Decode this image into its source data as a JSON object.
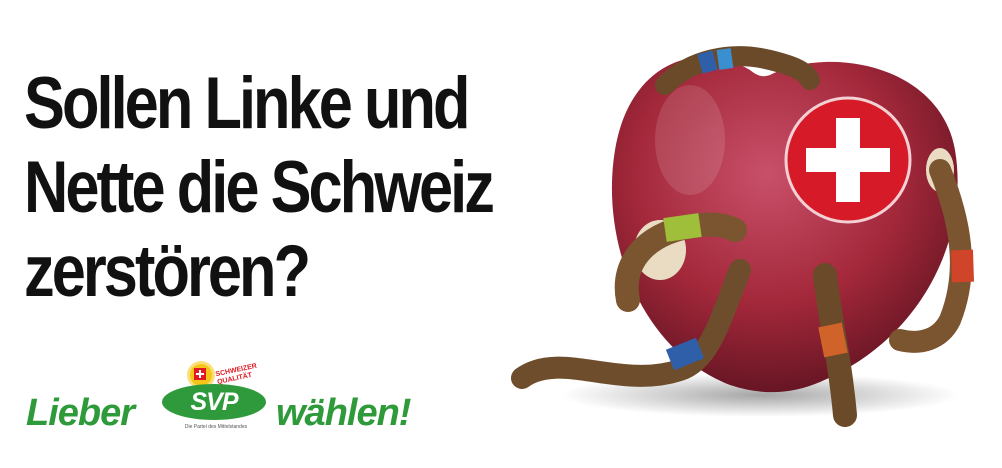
{
  "headline": {
    "line1": "Sollen Linke und",
    "line2": "Nette die Schweiz",
    "line3": "zerstören?"
  },
  "slogan": {
    "before": "Lieber",
    "after": "wählen!"
  },
  "logo": {
    "name": "SVP",
    "quality_line1": "SCHWEIZER",
    "quality_line2": "QUALITÄT",
    "tagline": "Die Partei des Mittelstandes"
  },
  "colors": {
    "headline": "#111111",
    "green": "#2e9a3a",
    "swiss_red": "#e01a22",
    "apple_red": "#a3283a"
  }
}
